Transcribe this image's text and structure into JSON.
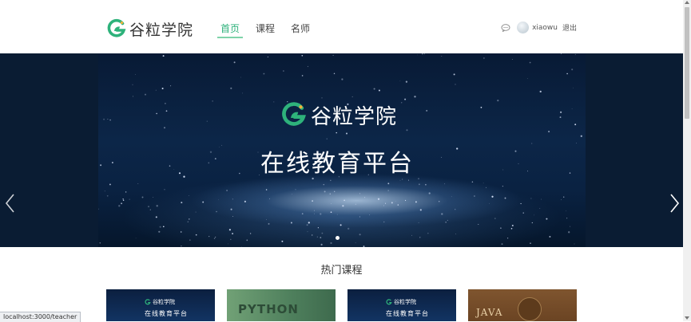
{
  "header": {
    "logo_text": "谷粒学院",
    "nav": [
      {
        "label": "首页",
        "active": true
      },
      {
        "label": "课程",
        "active": false
      },
      {
        "label": "名师",
        "active": false
      }
    ],
    "message_icon": "chat-bubble-icon",
    "username": "xiaowu",
    "logout_label": "退出"
  },
  "banner": {
    "logo_text": "谷粒学院",
    "tagline": "在线教育平台",
    "prev_icon": "chevron-left-icon",
    "next_icon": "chevron-right-icon",
    "slide_count": 1,
    "active_slide": 1
  },
  "section": {
    "title": "热门课程"
  },
  "courses": [
    {
      "logo_text": "谷粒学院",
      "subtitle": "在线教育平台",
      "style": "dark"
    },
    {
      "title": "PYTHON",
      "style": "python"
    },
    {
      "logo_text": "谷粒学院",
      "subtitle": "在线教育平台",
      "style": "dark"
    },
    {
      "title": "JAVA",
      "style": "java"
    }
  ],
  "status_bar": {
    "url": "localhost:3000/teacher"
  },
  "colors": {
    "brand_green": "#2eb27b",
    "banner_bg": "#0a1c33",
    "text": "#333333"
  }
}
